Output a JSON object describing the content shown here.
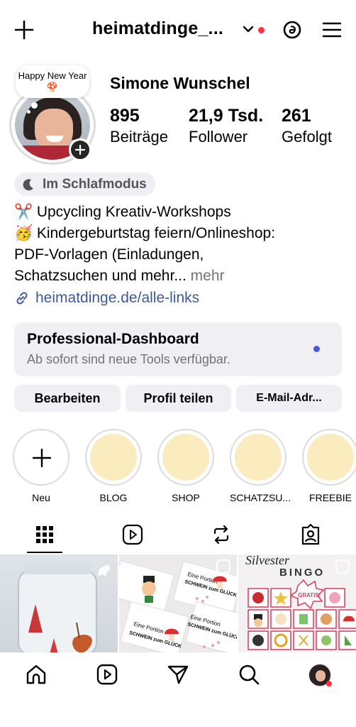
{
  "header": {
    "username": "heimatdinge_...",
    "create_icon": "plus-icon",
    "threads_icon": "threads-icon",
    "menu_icon": "hamburger-menu-icon",
    "notification_color": "#ff3040"
  },
  "profile": {
    "note": "Happy New Year🍄",
    "full_name": "Simone Wunschel",
    "stats": [
      {
        "value": "895",
        "label": "Beiträge"
      },
      {
        "value": "21,9 Tsd.",
        "label": "Follower"
      },
      {
        "value": "261",
        "label": "Gefolgt"
      }
    ],
    "status": "Im Schlafmodus",
    "bio_lines": [
      {
        "emoji": "✂️",
        "text": " Upcycling Kreativ-Workshops"
      },
      {
        "emoji": "🥳",
        "text": " Kindergeburtstag feiern/Onlineshop:"
      },
      {
        "emoji": "",
        "text": "PDF-Vorlagen (Einladungen,"
      },
      {
        "emoji": "",
        "text": "Schatzsuchen und mehr"
      }
    ],
    "bio_ellipsis": "...",
    "bio_more": " mehr",
    "link": "heimatdinge.de/alle-links",
    "link_color": "#3d5a9e"
  },
  "dashboard": {
    "title": "Professional-Dashboard",
    "subtitle": "Ab sofort sind neue Tools verfügbar.",
    "dot_color": "#4a5bdc"
  },
  "buttons": {
    "edit": "Bearbeiten",
    "share": "Profil teilen",
    "email": "E-Mail-Adr..."
  },
  "highlights": [
    {
      "label": "Neu"
    },
    {
      "label": "BLOG"
    },
    {
      "label": "SHOP"
    },
    {
      "label": "SCHATZSU..."
    },
    {
      "label": "FREEBIE"
    }
  ],
  "tabs": [
    {
      "icon": "grid-icon",
      "active": true
    },
    {
      "icon": "reels-icon",
      "active": false
    },
    {
      "icon": "repost-icon",
      "active": false
    },
    {
      "icon": "tagged-icon",
      "active": false
    }
  ],
  "grid": {
    "cell2_texts": [
      "Eine Portion",
      "SCHWEIN zum GLÜCK",
      "Eine Portion",
      "SCHWEIN zum GLÜCK",
      "Eine Portion",
      "SCHWEIN zum GLÜCK"
    ],
    "cell3_title": "Silvester",
    "cell3_subtitle": "BINGO",
    "cell3_badge": "GRATIS!"
  },
  "bottom_nav": [
    {
      "icon": "home-icon"
    },
    {
      "icon": "reels-icon"
    },
    {
      "icon": "direct-messages-icon"
    },
    {
      "icon": "search-icon"
    },
    {
      "icon": "profile-avatar"
    }
  ]
}
